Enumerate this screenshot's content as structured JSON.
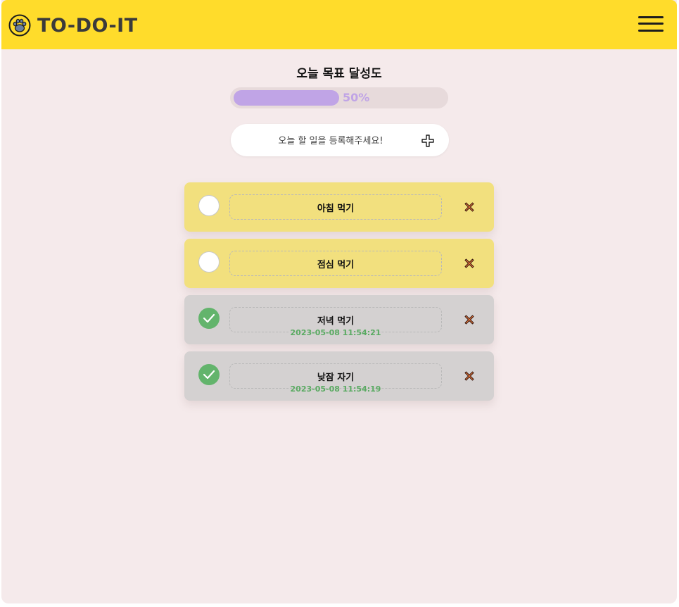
{
  "app": {
    "title": "TO-DO-IT"
  },
  "progress": {
    "title": "오늘 목표 달성도",
    "value": 0.5,
    "label": "50%"
  },
  "add": {
    "placeholder": "오늘 할 일을 등록해주세요!"
  },
  "todos": [
    {
      "text": "아침 먹기",
      "done": false,
      "time": ""
    },
    {
      "text": "점심 먹기",
      "done": false,
      "time": ""
    },
    {
      "text": "저녁 먹기",
      "done": true,
      "time": "2023-05-08 11:54:21"
    },
    {
      "text": "낮잠 자기",
      "done": true,
      "time": "2023-05-08 11:54:19"
    }
  ],
  "colors": {
    "topbar": "#ffdc2b",
    "background": "#f5eaeb",
    "pending_card": "#f2e07e",
    "done_card": "#d4d1d1",
    "progress": "#c0a4e6",
    "check": "#63b46c",
    "delete": "#e5743a"
  },
  "icons": {
    "logo": "paw-icon",
    "menu": "hamburger-menu-icon",
    "add": "plus-icon",
    "check": "checkmark-icon",
    "delete": "close-x-icon"
  }
}
